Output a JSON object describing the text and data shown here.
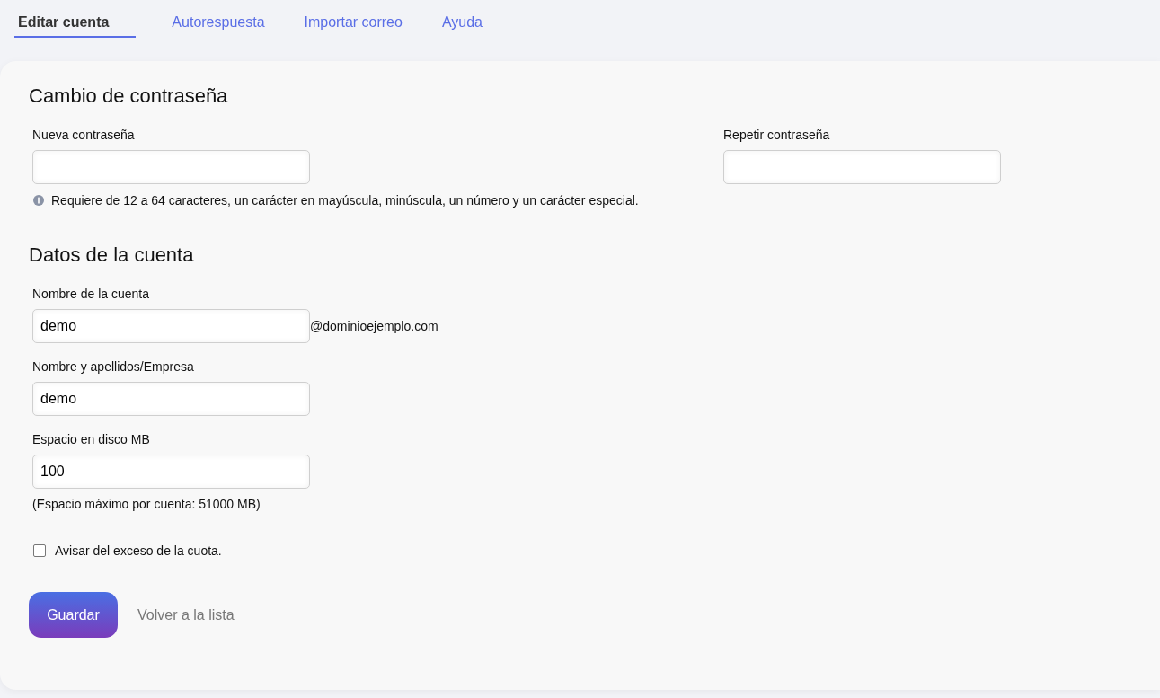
{
  "tabs": [
    {
      "label": "Editar cuenta",
      "selected": true
    },
    {
      "label": "Autorespuesta",
      "selected": false
    },
    {
      "label": "Importar correo",
      "selected": false
    },
    {
      "label": "Ayuda",
      "selected": false
    }
  ],
  "password_section": {
    "title": "Cambio de contraseña",
    "fields": [
      {
        "label": "Nueva contraseña"
      },
      {
        "label": "Repetir contraseña"
      }
    ],
    "hint": "Requiere de 12 a 64 caracteres, un carácter en mayúscula, minúscula, un número y un carácter especial."
  },
  "account_section": {
    "title": "Datos de la cuenta",
    "fields": [
      {
        "label": "Nombre de la cuenta",
        "value": "demo",
        "suffix": "@dominioejemplo.com"
      },
      {
        "label": "Nombre y apellidos/Empresa",
        "value": "demo"
      },
      {
        "label": "Espacio en disco MB",
        "value": "100",
        "note": "(Espacio máximo por cuenta: 51000 MB)"
      }
    ],
    "checkbox": {
      "label": "Avisar del exceso de la cuota.",
      "checked": false
    }
  },
  "actions": {
    "save": "Guardar",
    "back": "Volver a la lista"
  }
}
